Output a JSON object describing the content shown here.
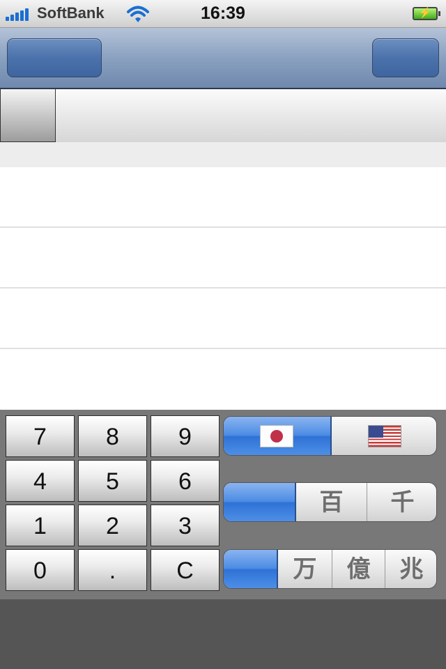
{
  "status_bar": {
    "carrier": "SoftBank",
    "time": "16:39",
    "signal_icon": "signal-bars-icon",
    "wifi_icon": "wifi-icon",
    "battery_icon": "battery-charging-icon",
    "charge_symbol": "⚡"
  },
  "nav_bar": {
    "left_button_label": "",
    "right_button_label": ""
  },
  "keypad": {
    "keys": [
      "7",
      "8",
      "9",
      "4",
      "5",
      "6",
      "1",
      "2",
      "3",
      "0",
      ".",
      "C"
    ]
  },
  "currency_selector": {
    "options": [
      {
        "icon": "japan-flag-icon",
        "selected": true
      },
      {
        "icon": "us-flag-icon",
        "selected": false
      }
    ]
  },
  "unit_selector_1": {
    "options": [
      "",
      "百",
      "千"
    ],
    "selected_index": 0
  },
  "unit_selector_2": {
    "options": [
      "",
      "万",
      "億",
      "兆"
    ],
    "selected_index": 0
  },
  "colors": {
    "nav_bar": "#8aa1c0",
    "segment_selected": "#4c8ce4",
    "keypad_background": "#787878"
  }
}
